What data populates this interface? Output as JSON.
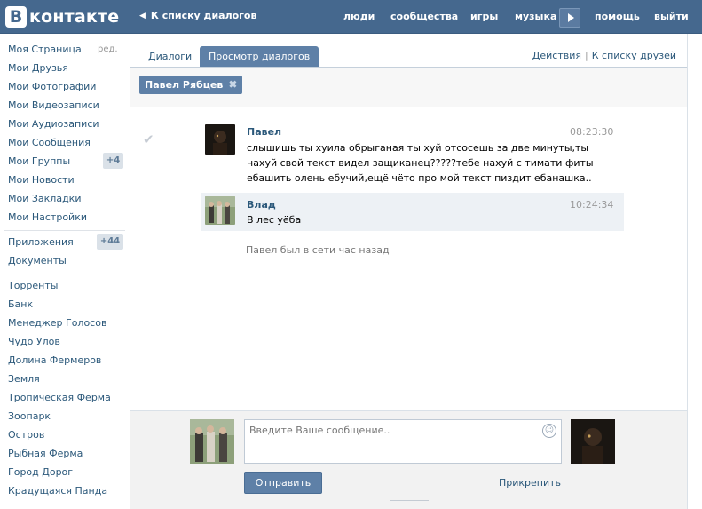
{
  "topbar": {
    "logo_letter": "В",
    "logo_text": "контакте",
    "back_link": "К списку диалогов",
    "nav": {
      "people": "люди",
      "communities": "сообщества",
      "games": "игры",
      "music": "музыка",
      "help": "помощь",
      "logout": "выйти"
    },
    "colors": {
      "bar": "#45688e",
      "accent": "#5e80a7"
    }
  },
  "sidebar": {
    "edit_label": "ред.",
    "items": [
      "Моя Страница",
      "Мои Друзья",
      "Мои Фотографии",
      "Мои Видеозаписи",
      "Мои Аудиозаписи",
      "Мои Сообщения",
      "Мои Группы",
      "Мои Новости",
      "Мои Закладки",
      "Мои Настройки"
    ],
    "groups_count": "+4",
    "apps_label": "Приложения",
    "apps_count": "+44",
    "documents_label": "Документы",
    "apps": [
      "Торренты",
      "Банк",
      "Менеджер Голосов",
      "Чудо Улов",
      "Долина Фермеров",
      "Земля",
      "Тропическая Ферма",
      "Зоопарк",
      "Остров",
      "Рыбная Ферма",
      "Город Дорог",
      "Крадущаяся Панда"
    ]
  },
  "tabs": {
    "dialogs": "Диалоги",
    "view_dialogs": "Просмотр диалогов",
    "actions": "Действия",
    "separator": "|",
    "to_friends": "К списку друзей"
  },
  "filter": {
    "chip_label": "Павел Рябцев",
    "chip_close": "✖"
  },
  "messages": [
    {
      "author": "Павел",
      "time": "08:23:30",
      "lines": [
        "слышишь ты хуила обрыганая ты хуй отсосешь за две минуты,ты",
        "нахуй свой текст видел защиканец?????тебе нахуй с тимати фиты",
        "ебашить олень ебучий,ещё чёто про мой текст пиздит ебанашка.."
      ]
    },
    {
      "author": "Влад",
      "time": "10:24:34",
      "lines": [
        "В лес уёба"
      ]
    }
  ],
  "online_status": "Павел был в сети час назад",
  "compose": {
    "placeholder": "Введите Ваше сообщение..",
    "send_label": "Отправить",
    "attach_label": "Прикрепить"
  }
}
